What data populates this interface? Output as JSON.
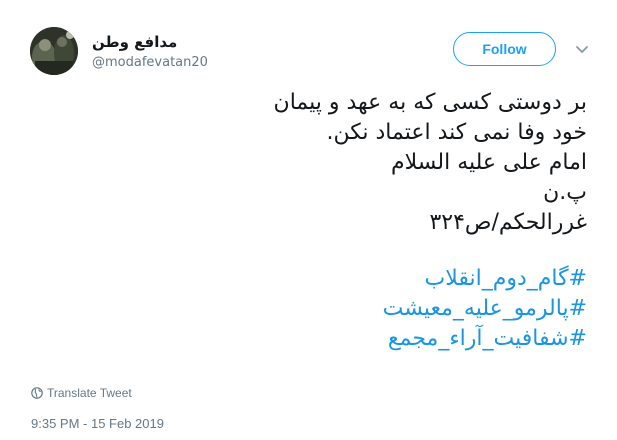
{
  "author": {
    "display_name": "مدافع وطن",
    "screen_name": "@modafevatan20",
    "avatar_icon": "avatar-soldier-photo"
  },
  "follow_button": {
    "label": "Follow"
  },
  "menu": {
    "icon": "chevron-down-icon"
  },
  "tweet": {
    "lines": [
      "بر دوستی کسی که به عهد و پیمان",
      "خود وفا نمی کند اعتماد نکن.",
      "امام علی علیه السلام",
      "پ.ن",
      "غررالحکم/ص۳۲۴"
    ],
    "hashtags": [
      "#گام_دوم_انقلاب",
      "#پالرمو_علیه_معیشت",
      "#شفافیت_آراء_مجمع"
    ]
  },
  "translate": {
    "label": "Translate Tweet",
    "icon": "globe-icon"
  },
  "timestamp": "9:35 PM - 15 Feb 2019",
  "colors": {
    "accent": "#1da1f2",
    "hashtag": "#1b95e0",
    "muted": "#657786",
    "text": "#14171a"
  }
}
